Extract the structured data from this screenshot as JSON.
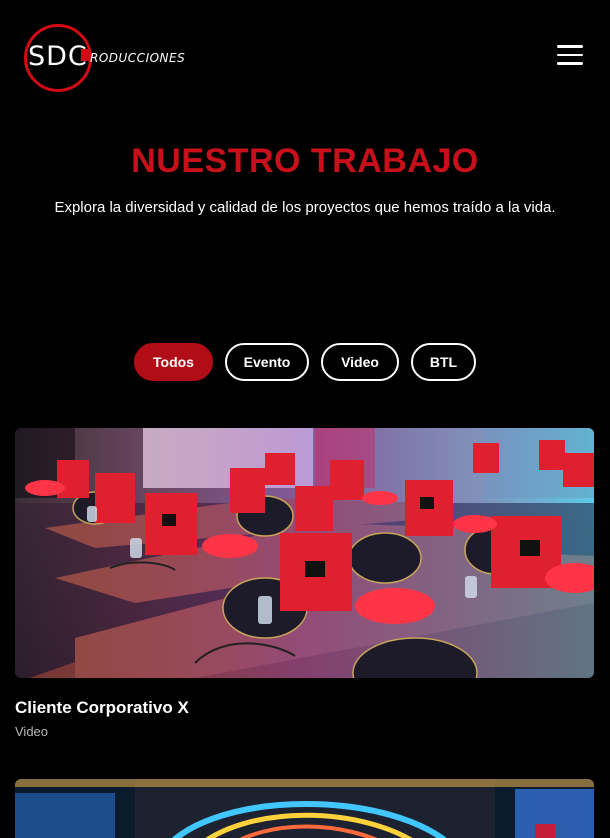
{
  "brand": {
    "logo_text": "SDC",
    "logo_sub": "RODUCCIONES",
    "accent": "#c8101b"
  },
  "nav": {
    "menu_icon": "hamburger-icon"
  },
  "hero": {
    "title": "NUESTRO TRABAJO",
    "subtitle": "Explora la diversidad y calidad de los proyectos que hemos traído a la vida."
  },
  "filters": [
    {
      "label": "Todos",
      "active": true
    },
    {
      "label": "Evento",
      "active": false
    },
    {
      "label": "Video",
      "active": false
    },
    {
      "label": "BTL",
      "active": false
    }
  ],
  "projects": [
    {
      "title": "Cliente Corporativo X",
      "category": "Video"
    }
  ]
}
